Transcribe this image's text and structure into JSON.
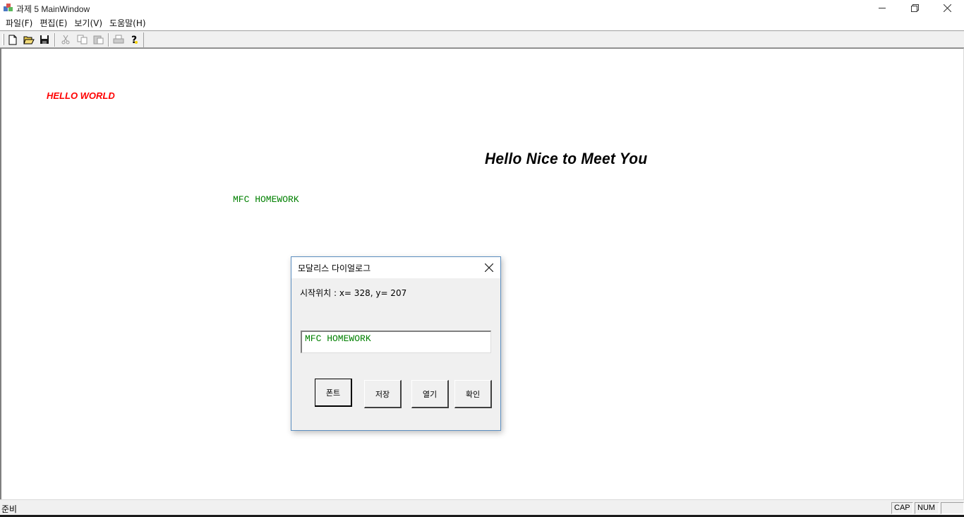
{
  "window": {
    "title": "과제 5 MainWindow",
    "minimize_glyph": "—",
    "maximize_glyph": "❐",
    "close_glyph": "✕"
  },
  "menu": {
    "items": [
      "파일(F)",
      "편집(E)",
      "보기(V)",
      "도움말(H)"
    ]
  },
  "toolbar": {
    "buttons": [
      "new-file-icon",
      "open-folder-icon",
      "save-icon",
      "cut-icon",
      "copy-icon",
      "paste-icon",
      "print-icon",
      "help-icon"
    ]
  },
  "canvas": {
    "hello_world": "HELLO WORLD",
    "hello_world_color": "#ff0000",
    "nice_text": "Hello Nice to Meet You",
    "mfc_text": "MFC HOMEWORK",
    "mfc_color": "#008000"
  },
  "dialog": {
    "title": "모달리스 다이얼로그",
    "position_text": "시작위치 : x= 328, y= 207",
    "edit_value": "MFC HOMEWORK",
    "buttons": {
      "font": "폰트",
      "save": "저장",
      "open": "열기",
      "ok": "확인"
    }
  },
  "status": {
    "text": "준비",
    "cap": "CAP",
    "num": "NUM",
    "scrl": ""
  }
}
